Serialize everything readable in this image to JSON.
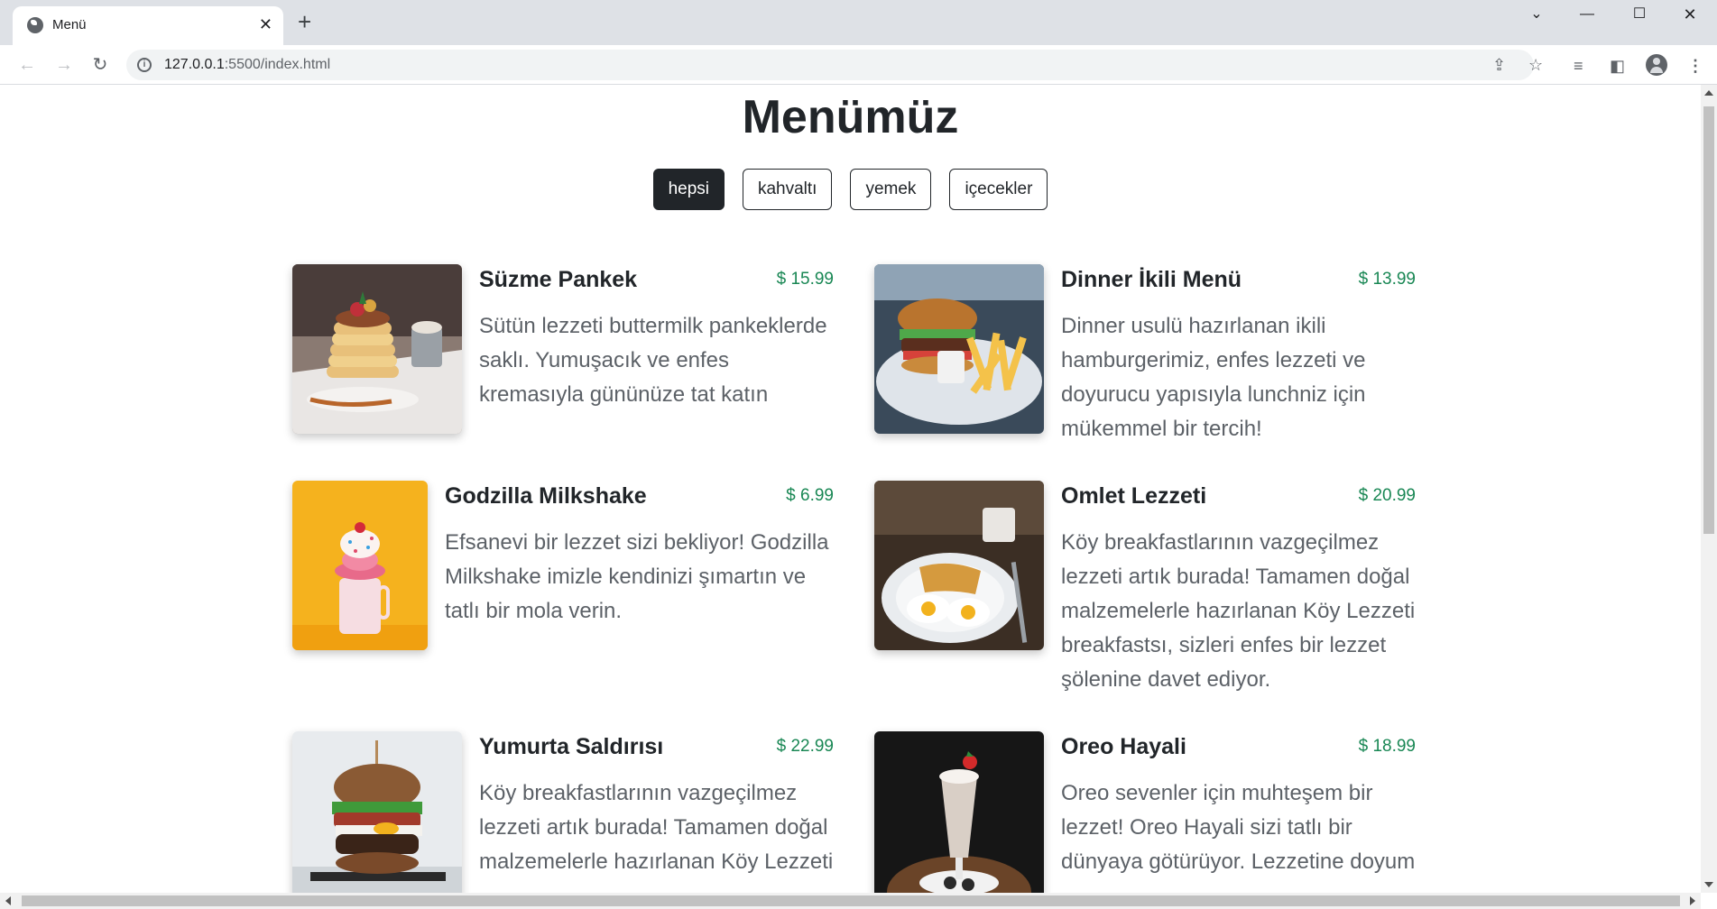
{
  "browser": {
    "tab_title": "Menü",
    "url_host": "127.0.0.1",
    "url_rest": ":5500/index.html",
    "icons": [
      "globe-icon",
      "close-icon",
      "plus-icon",
      "chevron-down-icon",
      "minimize-icon",
      "maximize-icon",
      "close-window-icon",
      "back-arrow-icon",
      "forward-arrow-icon",
      "reload-icon",
      "info-icon",
      "share-icon",
      "star-icon",
      "media-icon",
      "sidepanel-icon",
      "profile-icon",
      "menu-icon"
    ]
  },
  "page": {
    "title": "Menümüz",
    "filters": [
      {
        "label": "hepsi",
        "active": true
      },
      {
        "label": "kahvaltı",
        "active": false
      },
      {
        "label": "yemek",
        "active": false
      },
      {
        "label": "içecekler",
        "active": false
      }
    ],
    "items": [
      {
        "name": "Süzme Pankek",
        "price": "$ 15.99",
        "description": "Sütün lezzeti buttermilk pankeklerde saklı. Yumuşacık ve enfes kremasıyla gününüze tat katın",
        "image": "pancake-stack-photo"
      },
      {
        "name": "Dinner İkili Menü",
        "price": "$ 13.99",
        "description": "Dinner usulü hazırlanan ikili hamburgerimiz, enfes lezzeti ve doyurucu yapısıyla lunchniz için mükemmel bir tercih!",
        "image": "burger-fries-photo"
      },
      {
        "name": "Godzilla Milkshake",
        "price": "$ 6.99",
        "description": "Efsanevi bir lezzet sizi bekliyor! Godzilla Milkshake imizle kendinizi şımartın ve tatlı bir mola verin.",
        "image": "milkshake-photo"
      },
      {
        "name": "Omlet Lezzeti",
        "price": "$ 20.99",
        "description": "Köy breakfastlarının vazgeçilmez lezzeti artık burada! Tamamen doğal malzemelerle hazırlanan Köy Lezzeti breakfastsı, sizleri enfes bir lezzet şölenine davet ediyor.",
        "image": "fried-eggs-photo"
      },
      {
        "name": "Yumurta Saldırısı",
        "price": "$ 22.99",
        "description": "Köy breakfastlarının vazgeçilmez lezzeti artık burada! Tamamen doğal malzemelerle hazırlanan Köy Lezzeti",
        "image": "egg-burger-photo"
      },
      {
        "name": "Oreo Hayali",
        "price": "$ 18.99",
        "description": "Oreo sevenler için muhteşem bir lezzet! Oreo Hayali sizi tatlı bir dünyaya götürüyor. Lezzetine doyum",
        "image": "oreo-shake-photo"
      }
    ]
  },
  "colors": {
    "chrome_bg": "#dee1e6",
    "dark": "#212529",
    "price_green": "#198754",
    "desc_gray": "#5c6167"
  }
}
